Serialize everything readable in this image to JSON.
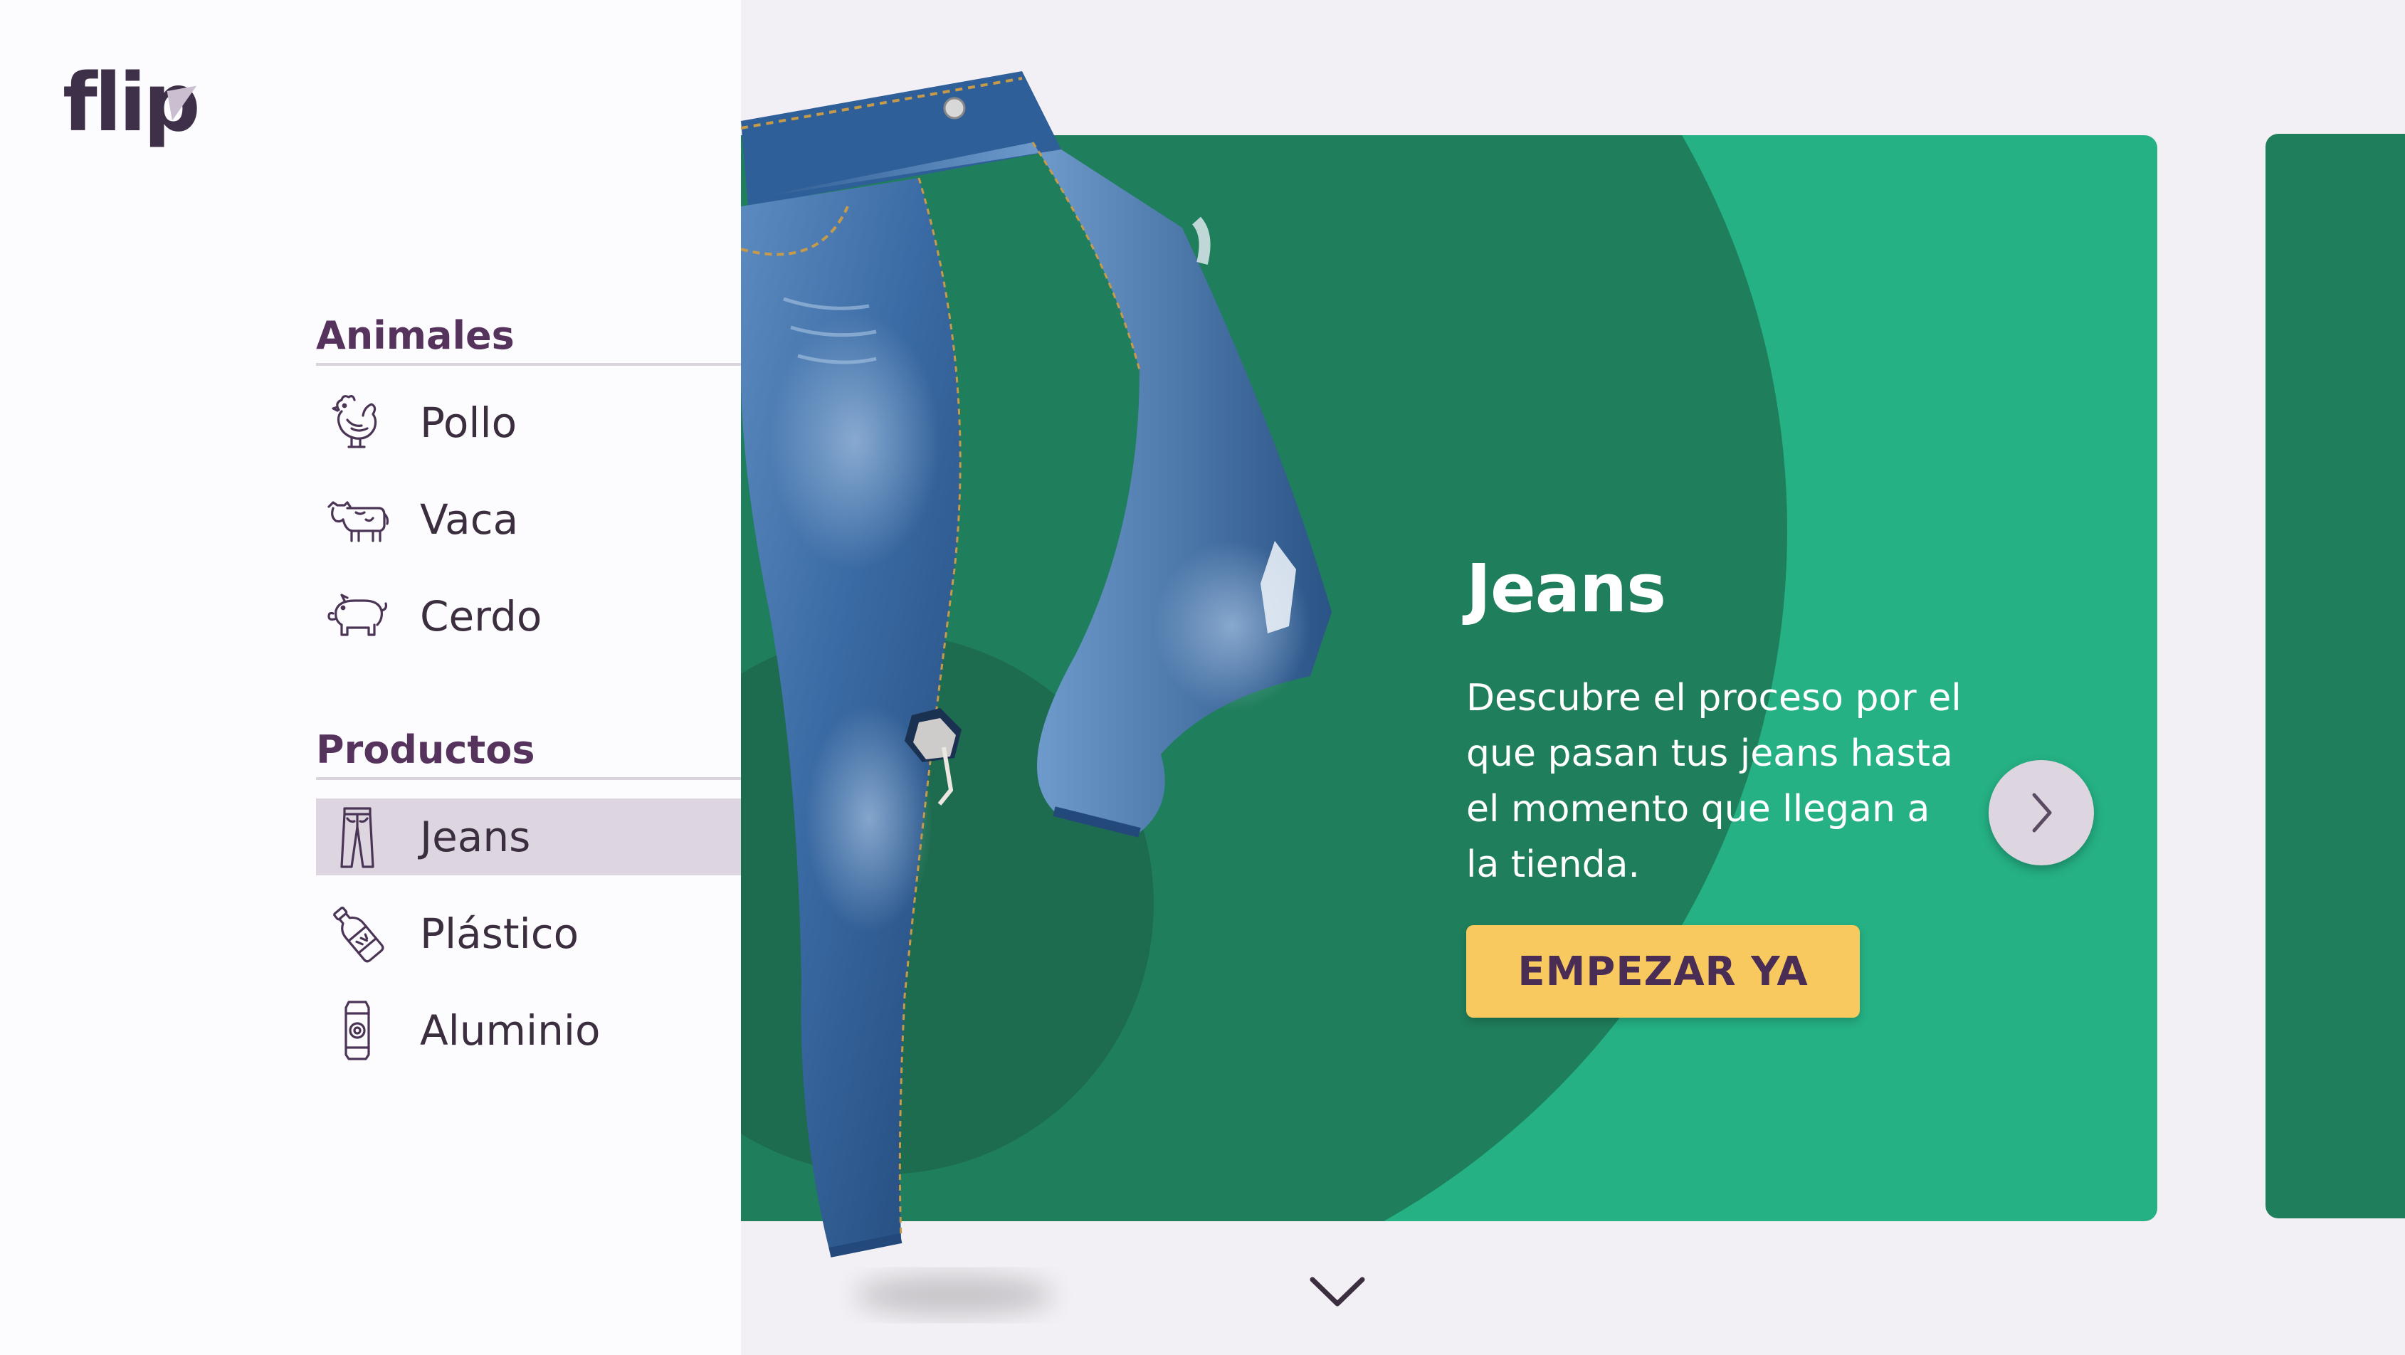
{
  "brand": {
    "logo_text": "flip"
  },
  "sidebar": {
    "sections": [
      {
        "heading": "Animales",
        "items": [
          {
            "label": "Pollo",
            "icon": "chicken-icon"
          },
          {
            "label": "Vaca",
            "icon": "cow-icon"
          },
          {
            "label": "Cerdo",
            "icon": "pig-icon"
          }
        ]
      },
      {
        "heading": "Productos",
        "items": [
          {
            "label": "Jeans",
            "icon": "jeans-icon",
            "active": true
          },
          {
            "label": "Plástico",
            "icon": "bottle-icon"
          },
          {
            "label": "Aluminio",
            "icon": "can-icon"
          }
        ]
      }
    ]
  },
  "card": {
    "title": "Jeans",
    "description": "Descubre el proceso por el que pasan tus jeans hasta el momento que llegan a la tienda.",
    "cta_label": "EMPEZAR YA",
    "image": "jeans-photo"
  },
  "controls": {
    "next_icon": "chevron-right-icon",
    "scroll_icon": "chevron-down-icon"
  },
  "colors": {
    "sidebar_heading": "#56335d",
    "card_light_green": "#25b184",
    "card_dark_green": "#1f7e5b",
    "cta_yellow": "#f8c95f",
    "active_item_bg": "#ddd6e0"
  }
}
